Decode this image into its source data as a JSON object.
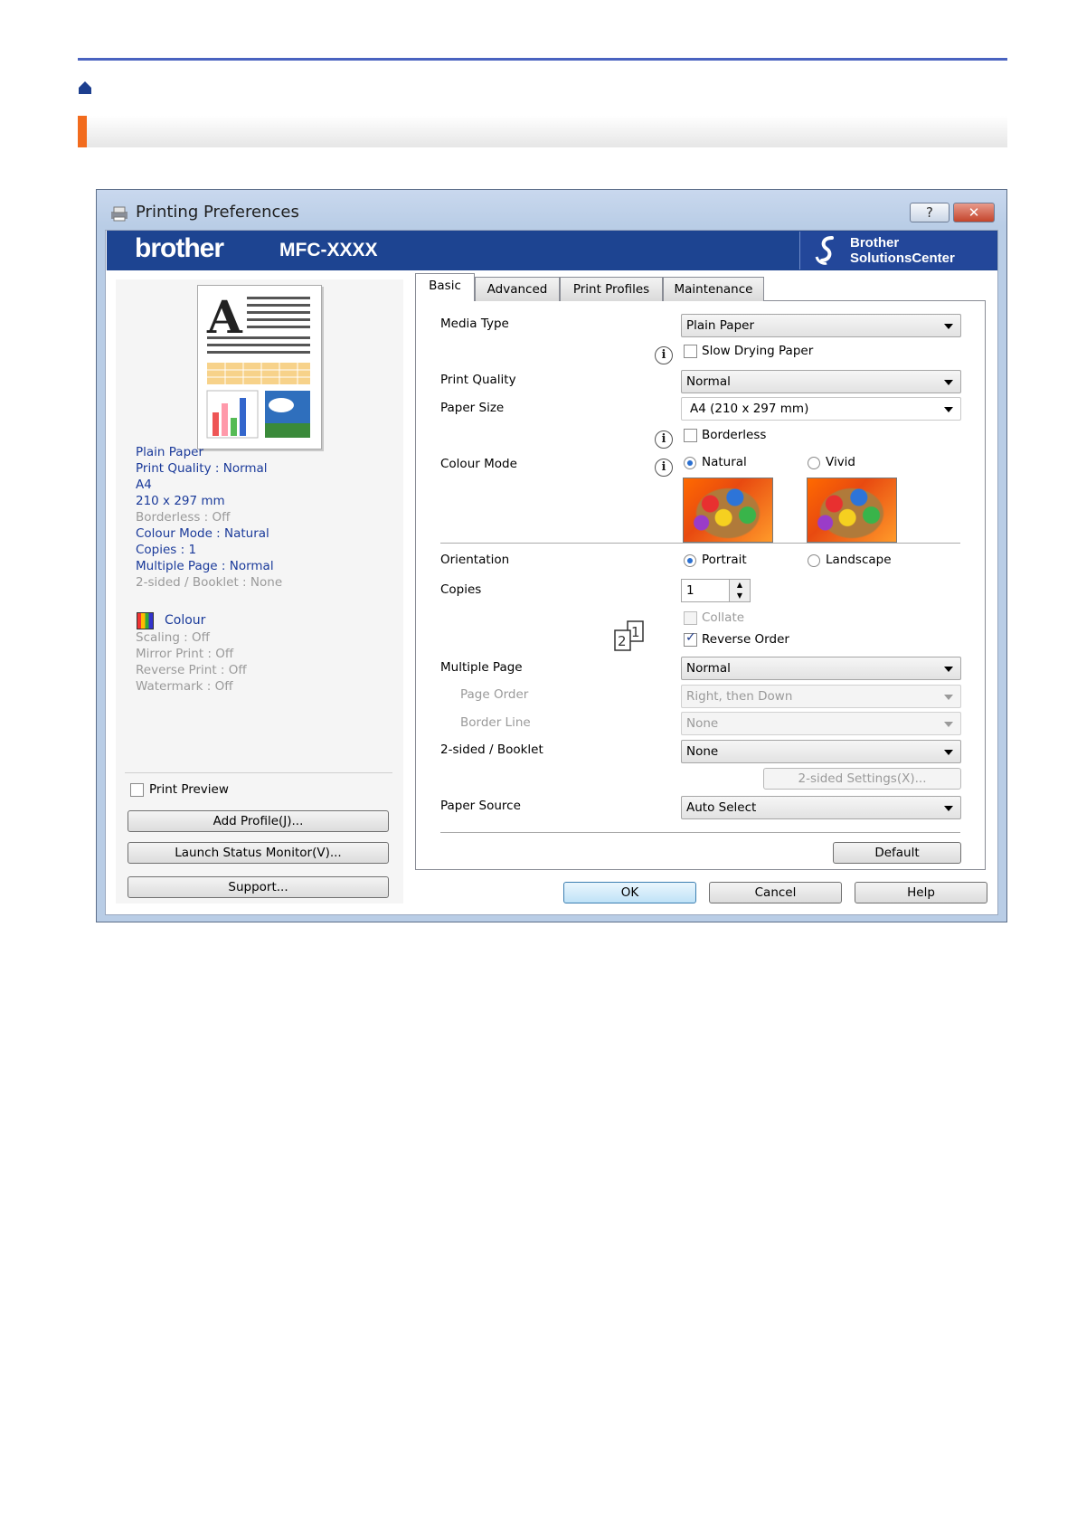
{
  "dialog": {
    "title": "Printing Preferences",
    "help_btn": "?",
    "close_btn": "✕",
    "brand": "brother",
    "model": "MFC-XXXX",
    "bsc_line1": "Brother",
    "bsc_line2": "SolutionsCenter"
  },
  "summary": {
    "lines": [
      {
        "text": "Plain Paper",
        "enabled": true
      },
      {
        "text": "Print Quality : Normal",
        "enabled": true
      },
      {
        "text": "A4",
        "enabled": true
      },
      {
        "text": "210 x 297 mm",
        "enabled": true
      },
      {
        "text": "Borderless : Off",
        "enabled": false
      },
      {
        "text": "Colour Mode : Natural",
        "enabled": true
      },
      {
        "text": "Copies : 1",
        "enabled": true
      },
      {
        "text": "Multiple Page : Normal",
        "enabled": true
      },
      {
        "text": "2-sided / Booklet : None",
        "enabled": false
      }
    ],
    "colour_label": "Colour",
    "extra": [
      "Scaling : Off",
      "Mirror Print : Off",
      "Reverse Print : Off",
      "Watermark : Off"
    ]
  },
  "left": {
    "print_preview": "Print Preview",
    "add_profile": "Add Profile(J)...",
    "launch_status": "Launch Status Monitor(V)...",
    "support": "Support..."
  },
  "tabs": [
    "Basic",
    "Advanced",
    "Print Profiles",
    "Maintenance"
  ],
  "basic": {
    "media_type_label": "Media Type",
    "media_type_value": "Plain Paper",
    "slow_drying": "Slow Drying Paper",
    "print_quality_label": "Print Quality",
    "print_quality_value": "Normal",
    "paper_size_label": "Paper Size",
    "paper_size_value": "A4 (210 x 297 mm)",
    "borderless": "Borderless",
    "colour_mode_label": "Colour Mode",
    "natural": "Natural",
    "vivid": "Vivid",
    "orientation_label": "Orientation",
    "portrait": "Portrait",
    "landscape": "Landscape",
    "copies_label": "Copies",
    "copies_value": "1",
    "collate": "Collate",
    "reverse_order": "Reverse Order",
    "multiple_page_label": "Multiple Page",
    "multiple_page_value": "Normal",
    "page_order_label": "Page Order",
    "page_order_value": "Right, then Down",
    "border_line_label": "Border Line",
    "border_line_value": "None",
    "two_sided_label": "2-sided / Booklet",
    "two_sided_value": "None",
    "two_sided_settings": "2-sided Settings(X)...",
    "paper_source_label": "Paper Source",
    "paper_source_value": "Auto Select",
    "default_btn": "Default"
  },
  "footer": {
    "ok": "OK",
    "cancel": "Cancel",
    "help": "Help"
  }
}
